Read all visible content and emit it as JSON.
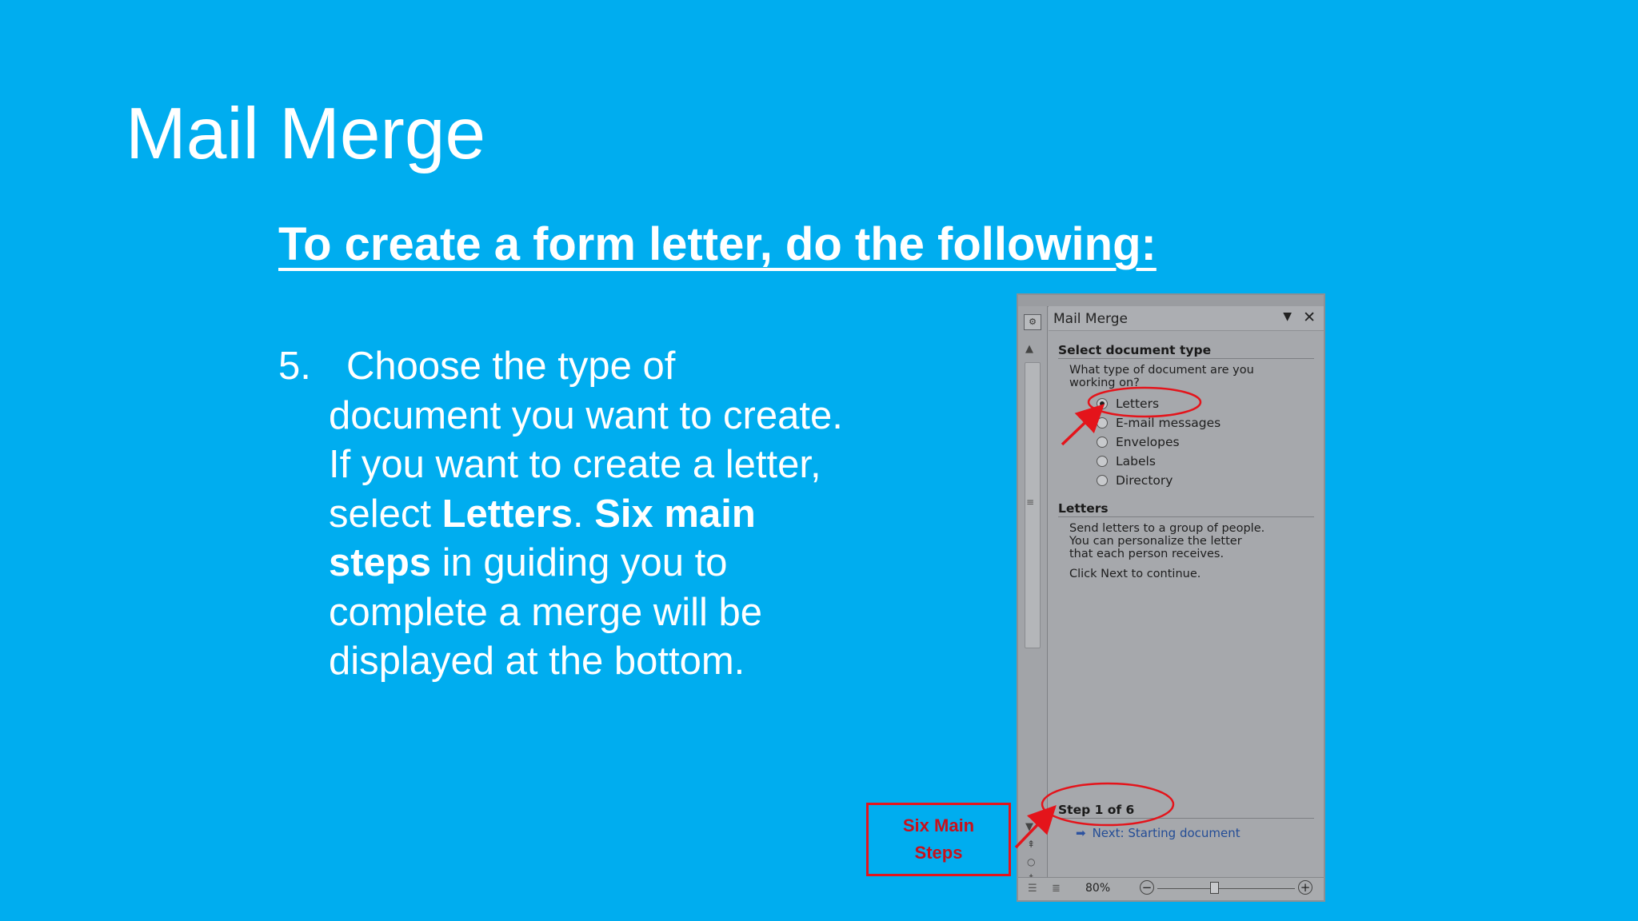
{
  "slide": {
    "title": "Mail Merge",
    "subtitle": "To create a form letter, do the following:",
    "step": {
      "number": "5.",
      "line1": "Choose the type of",
      "line2": "document you want to create.",
      "line3": "If you want to create a letter,",
      "line4_pre": "select ",
      "line4_bold1": "Letters",
      "line4_mid": ". ",
      "line4_bold2": "Six main",
      "line5_bold": "steps",
      "line5_rest": " in guiding you to",
      "line6": "complete a merge will be",
      "line7": "displayed at the bottom."
    }
  },
  "pane": {
    "title": "Mail Merge",
    "section1": {
      "heading": "Select document type",
      "question_line1": "What type of document are you",
      "question_line2": "working on?",
      "options": [
        {
          "label": "Letters",
          "selected": true
        },
        {
          "label": "E-mail messages",
          "selected": false
        },
        {
          "label": "Envelopes",
          "selected": false
        },
        {
          "label": "Labels",
          "selected": false
        },
        {
          "label": "Directory",
          "selected": false
        }
      ]
    },
    "section2": {
      "heading": "Letters",
      "desc_line1": "Send letters to a group of people.",
      "desc_line2": "You can personalize the letter",
      "desc_line3": "that each person receives.",
      "instruction": "Click Next to continue."
    },
    "step": {
      "heading": "Step 1 of 6",
      "next_label": "Next: Starting document"
    },
    "status": {
      "zoom": "80%"
    }
  },
  "callout": {
    "line1": "Six Main",
    "line2": "Steps"
  },
  "colors": {
    "background": "#00adef",
    "annotation": "#e4141b",
    "link": "#244d96"
  }
}
